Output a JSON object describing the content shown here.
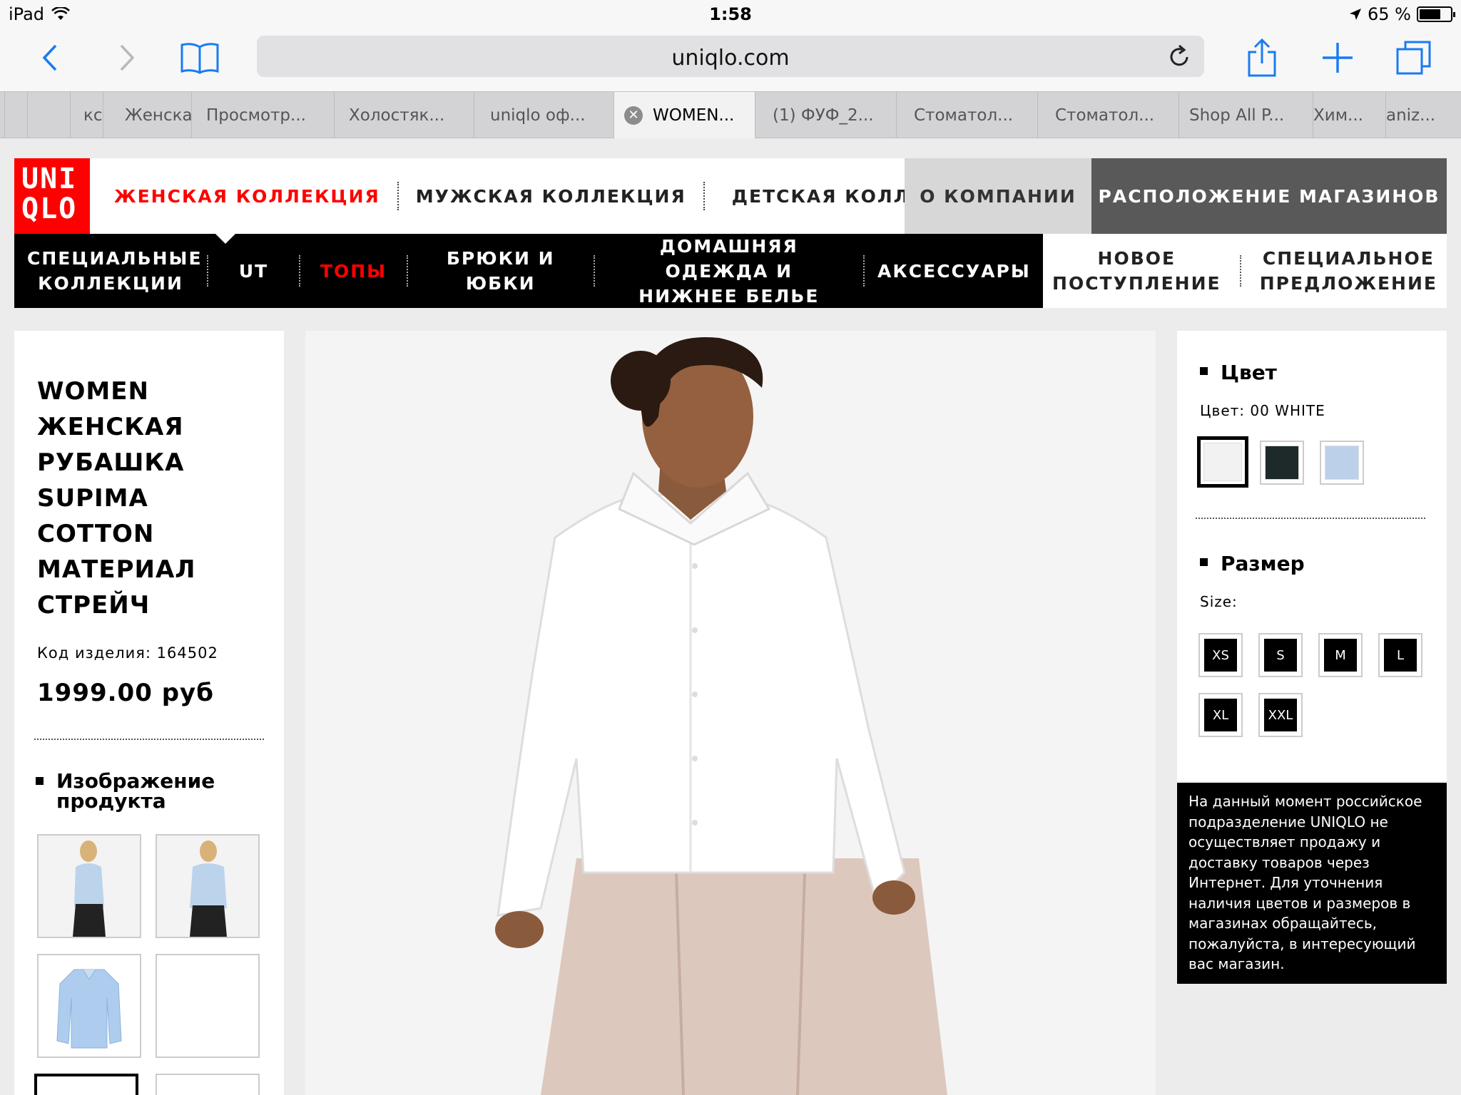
{
  "status_bar": {
    "device": "iPad",
    "time": "1:58",
    "battery": "65 %",
    "battery_level": 0.65
  },
  "browser": {
    "url": "uniqlo.com",
    "icons": [
      "back-icon",
      "forward-icon",
      "bookmarks-icon",
      "reload-icon",
      "share-icon",
      "new-tab-icon",
      "tabs-icon"
    ],
    "tabs": [
      {
        "label": "кс"
      },
      {
        "label": "Женска"
      },
      {
        "label": "Просмотр..."
      },
      {
        "label": "Холостяк..."
      },
      {
        "label": "uniqlo оф..."
      },
      {
        "label": "WOMEN...",
        "active": true
      },
      {
        "label": "(1) ФУФ_2..."
      },
      {
        "label": "Стоматол..."
      },
      {
        "label": "Стоматол..."
      },
      {
        "label": "Shop All P..."
      },
      {
        "label": "Хим..."
      },
      {
        "label": "aniz..."
      }
    ]
  },
  "header": {
    "logo_line1": "UNI",
    "logo_line2": "QLO",
    "nav": [
      "ЖЕНСКАЯ КОЛЛЕКЦИЯ",
      "МУЖСКАЯ КОЛЛЕКЦИЯ",
      "ДЕТСКАЯ КОЛЛЕКЦИЯ"
    ],
    "about": "О КОМПАНИИ",
    "stores": "РАСПОЛОЖЕНИЕ МАГАЗИНОВ",
    "brand_color": "#ff0000"
  },
  "subnav": {
    "items": [
      {
        "label": "СПЕЦИАЛЬНЫЕ\nКОЛЛЕКЦИИ"
      },
      {
        "label": "UT"
      },
      {
        "label": "ТОПЫ",
        "active": true
      },
      {
        "label": "БРЮКИ И ЮБКИ"
      },
      {
        "label": "ДОМАШНЯЯ ОДЕЖДА И\nНИЖНЕЕ БЕЛЬЕ"
      },
      {
        "label": "АКСЕССУАРЫ"
      }
    ],
    "right": [
      {
        "label": "НОВОЕ\nПОСТУПЛЕНИЕ"
      },
      {
        "label": "СПЕЦИАЛЬНОЕ\nПРЕДЛОЖЕНИЕ"
      }
    ]
  },
  "product": {
    "title": "WOMEN ЖЕНСКАЯ РУБАШКА SUPIMA COTTON МАТЕРИАЛ СТРЕЙЧ",
    "code": "Код изделия: 164502",
    "price": "1999.00 руб",
    "images_heading": "Изображение продукта"
  },
  "options": {
    "color_heading": "Цвет",
    "color_label": "Цвет: 00 WHITE",
    "colors": [
      {
        "hex": "#f2f2f2",
        "selected": true
      },
      {
        "hex": "#1e2a2a"
      },
      {
        "hex": "#bcd0ea"
      }
    ],
    "size_heading": "Размер",
    "size_label": "Size:",
    "sizes": [
      "XS",
      "S",
      "M",
      "L",
      "XL",
      "XXL"
    ]
  },
  "notice": "На данный момент российское подразделение UNIQLO не осуществляет продажу и доставку товаров через Интернет. Для уточнения наличия цветов и размеров в магазинах обращайтесь, пожалуйста, в интересующий вас магазин."
}
